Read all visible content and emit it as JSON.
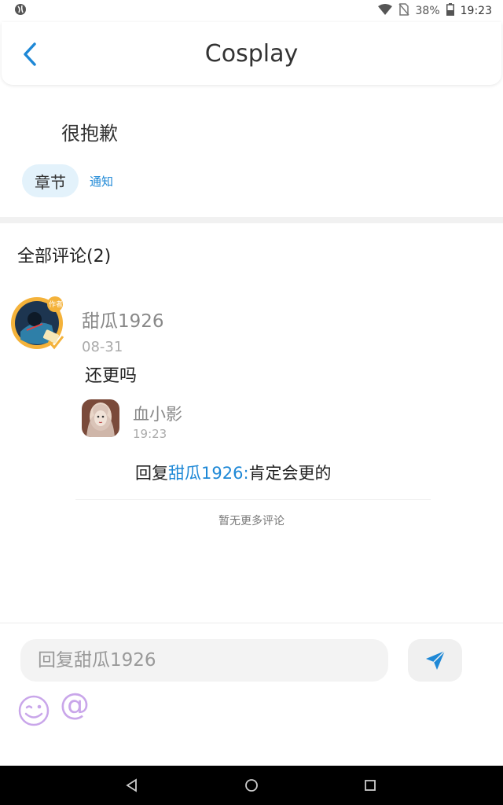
{
  "status_bar": {
    "battery": "38%",
    "time": "19:23"
  },
  "header": {
    "title": "Cosplay",
    "accent_color": "#1e88d6"
  },
  "notice": {
    "text": "很抱歉",
    "tag": "章节",
    "link": "通知"
  },
  "comments": {
    "title": "全部评论(2)",
    "items": [
      {
        "user": "甜瓜1926",
        "date": "08-31",
        "text": "还更吗",
        "avatar_badge": "作者",
        "replies": [
          {
            "user": "血小影",
            "time": "19:23",
            "prefix": "回复",
            "mention": "甜瓜1926:",
            "text": "肯定会更的"
          }
        ]
      }
    ],
    "no_more": "暂无更多评论"
  },
  "input": {
    "placeholder": "回复甜瓜1926"
  },
  "icons": {
    "back": "chevron-left-icon",
    "send": "paper-plane-icon",
    "emoji": "wink-face-icon",
    "at": "@",
    "nav_back": "triangle-back-icon",
    "nav_home": "circle-home-icon",
    "nav_recent": "square-recent-icon"
  }
}
